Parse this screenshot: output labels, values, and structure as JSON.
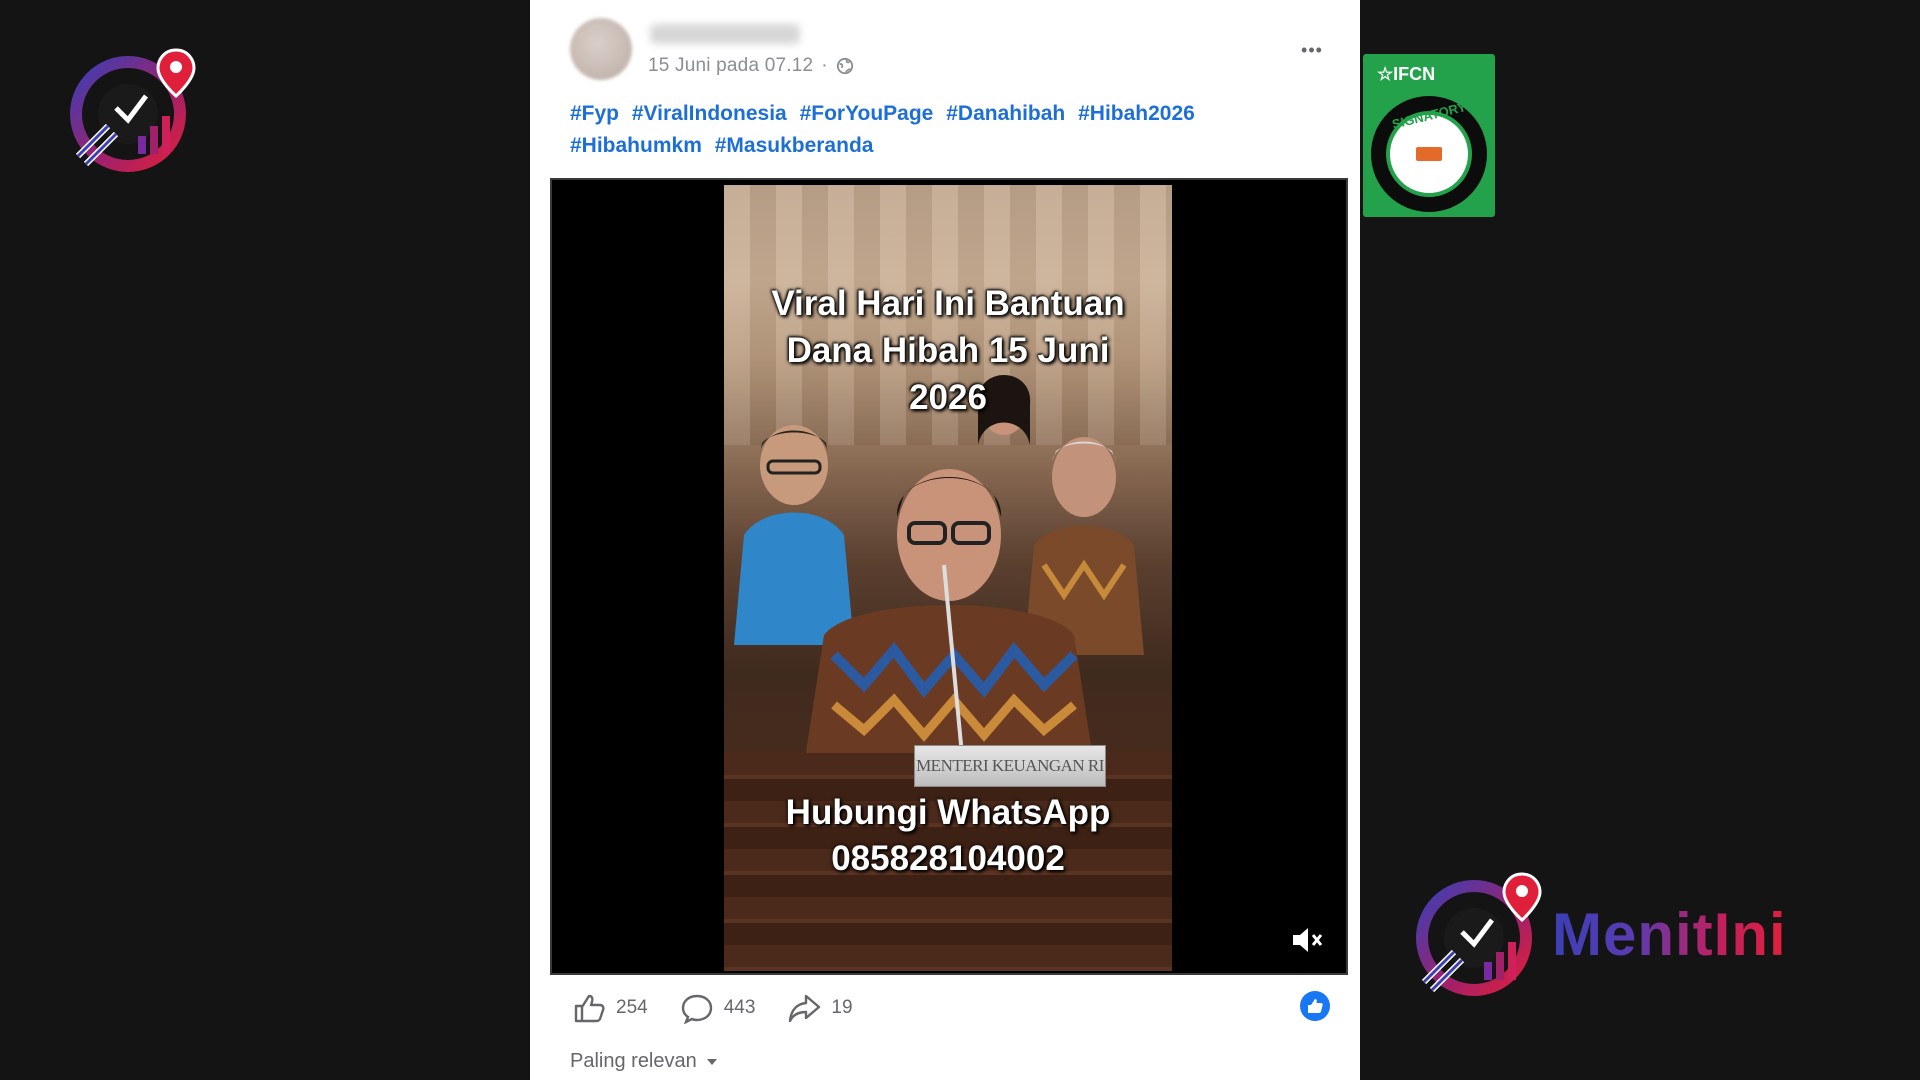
{
  "post": {
    "date": "15 Juni pada 07.12",
    "more_label": "•••",
    "hashtags": [
      "#Fyp",
      "#ViralIndonesia",
      "#ForYouPage",
      "#Danahibah",
      "#Hibah2026",
      "#Hibahumkm",
      "#Masukberanda"
    ]
  },
  "video": {
    "title_line1": "Viral Hari Ini Bantuan",
    "title_line2": "Dana Hibah 15 Juni",
    "title_line3": "2026",
    "nameplate": "MENTERI KEUANGAN RI",
    "contact_line1": "Hubungi WhatsApp",
    "contact_line2": "085828104002",
    "muted_icon": "speaker-muted-icon"
  },
  "actions": {
    "likes": "254",
    "comments": "443",
    "shares": "19",
    "sort_label": "Paling relevan"
  },
  "branding": {
    "brand_name": "MenitIni",
    "ifcn_label": "IFCN",
    "ifcn_seal_text": "SIGNATORY"
  },
  "colors": {
    "background": "#141414",
    "link": "#1d6fd8",
    "ifcn_green": "#23a14b",
    "brand_blue": "#3b3fb5",
    "brand_red": "#e0203a"
  }
}
